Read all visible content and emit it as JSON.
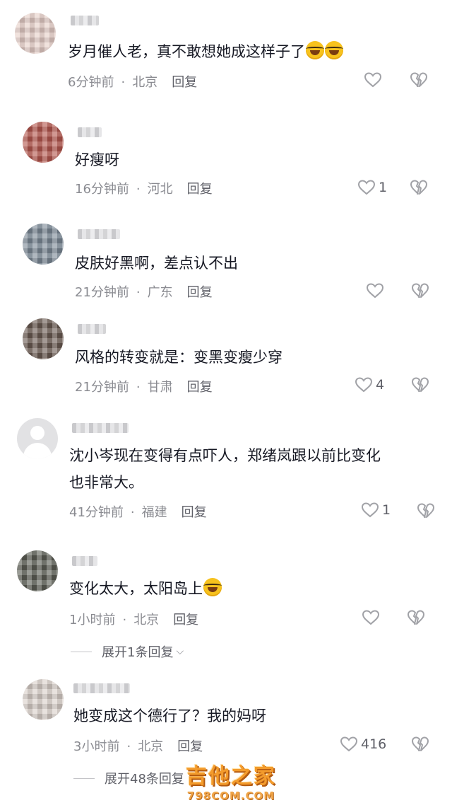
{
  "comments": [
    {
      "text": "岁月催人老，真不敢想她成这样子了",
      "emoji_count": 2,
      "time": "6分钟前",
      "location": "北京",
      "reply": "回复",
      "likes": ""
    },
    {
      "text": "好瘦呀",
      "emoji_count": 0,
      "time": "16分钟前",
      "location": "河北",
      "reply": "回复",
      "likes": "1"
    },
    {
      "text": "皮肤好黑啊，差点认不出",
      "emoji_count": 0,
      "time": "21分钟前",
      "location": "广东",
      "reply": "回复",
      "likes": ""
    },
    {
      "text": "风格的转变就是：变黑变瘦少穿",
      "emoji_count": 0,
      "time": "21分钟前",
      "location": "甘肃",
      "reply": "回复",
      "likes": "4"
    },
    {
      "text_line1": "沈小岑现在变得有点吓人，郑绪岚跟以前比变化",
      "text_line2": "也非常大。",
      "emoji_count": 0,
      "time": "41分钟前",
      "location": "福建",
      "reply": "回复",
      "likes": "1"
    },
    {
      "text": "变化太大，太阳岛上",
      "emoji_count": 1,
      "time": "1小时前",
      "location": "北京",
      "reply": "回复",
      "likes": "",
      "expand": "展开1条回复"
    },
    {
      "text": "她变成这个德行了？我的妈呀",
      "emoji_count": 0,
      "time": "3小时前",
      "location": "北京",
      "reply": "回复",
      "likes": "416",
      "expand": "展开48条回复"
    }
  ],
  "icons": {
    "like": "heart-outline-icon",
    "dislike": "broken-heart-icon",
    "avatar_default": "default-avatar-icon",
    "expand": "chevron-down-icon"
  },
  "watermark": {
    "line1": "吉他之家",
    "line2": "798COM.COM"
  },
  "colors": {
    "text": "#161823",
    "meta": "#8a8b91",
    "icon": "#a1a2a7",
    "watermark": "#f39b2c"
  }
}
